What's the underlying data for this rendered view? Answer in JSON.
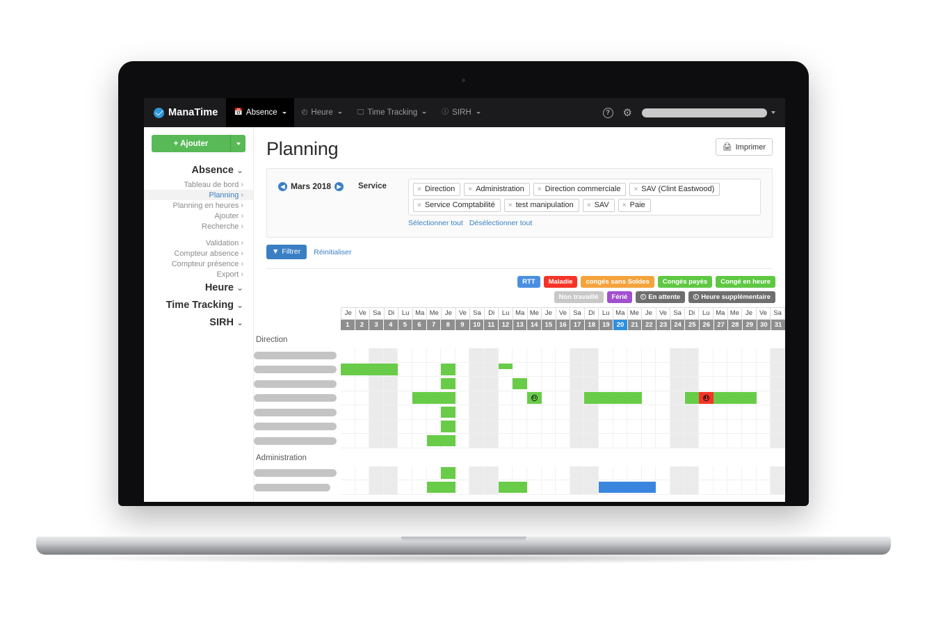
{
  "app": {
    "brand": "ManaTime",
    "brand_icon": "manatime-logo-icon"
  },
  "topnav": {
    "items": [
      {
        "label": "Absence",
        "icon": "calendar-icon",
        "active": true
      },
      {
        "label": "Heure",
        "icon": "clock-icon",
        "active": false
      },
      {
        "label": "Time Tracking",
        "icon": "device-icon",
        "active": false
      },
      {
        "label": "SIRH",
        "icon": "info-icon",
        "active": false
      }
    ],
    "help_icon": "question-mark-icon",
    "settings_icon": "gear-icon",
    "user_menu_placeholder": ""
  },
  "sidebar": {
    "add_button": "+ Ajouter",
    "add_caret_icon": "chevron-down-icon",
    "groups": [
      {
        "title": "Absence",
        "chevron": "⌄",
        "links": [
          {
            "label": "Tableau de bord",
            "current": false
          },
          {
            "label": "Planning",
            "current": true
          },
          {
            "label": "Planning en heures",
            "current": false
          },
          {
            "label": "Ajouter",
            "current": false
          },
          {
            "label": "Recherche",
            "current": false
          },
          {
            "spacer": true
          },
          {
            "label": "Validation",
            "current": false
          },
          {
            "label": "Compteur absence",
            "current": false
          },
          {
            "label": "Compteur présence",
            "current": false
          },
          {
            "label": "Export",
            "current": false
          }
        ]
      },
      {
        "title": "Heure",
        "chevron": "⌄",
        "links": []
      },
      {
        "title": "Time Tracking",
        "chevron": "⌄",
        "links": []
      },
      {
        "title": "SIRH",
        "chevron": "⌄",
        "links": []
      }
    ],
    "link_arrow": "›"
  },
  "page": {
    "title": "Planning",
    "print_button": "Imprimer",
    "print_icon": "printer-icon"
  },
  "filters": {
    "month": "Mars 2018",
    "prev_icon": "chevron-left-circle-icon",
    "next_icon": "chevron-right-circle-icon",
    "service_label": "Service",
    "tags": [
      "Direction",
      "Administration",
      "Direction commerciale",
      "SAV (Clint Eastwood)",
      "Service Comptabilité",
      "test manipulation",
      "SAV",
      "Paie"
    ],
    "tag_remove_icon": "×",
    "select_all": "Sélectionner tout",
    "deselect_all": "Désélectionner tout",
    "filter_button": "Filtrer",
    "filter_icon": "funnel-icon",
    "reset_button": "Réinitialiser"
  },
  "legend": {
    "row1": [
      {
        "label": "RTT",
        "color": "#4a8fe0"
      },
      {
        "label": "Maladie",
        "color": "#f53427"
      },
      {
        "label": "congés sans Soldes",
        "color": "#f5a33c"
      },
      {
        "label": "Congés payés",
        "color": "#5fc843"
      },
      {
        "label": "Congé en heure",
        "color": "#5fc843"
      }
    ],
    "row2": [
      {
        "label": "Non travaillé",
        "color": "#c8c8c8",
        "icon": null
      },
      {
        "label": "Férié",
        "color": "#a14fd0",
        "icon": null
      },
      {
        "label": "En attente",
        "color": "#6e6e6e",
        "icon": "pending-clock-icon"
      },
      {
        "label": "Heure supplémentaire",
        "color": "#6e6e6e",
        "icon": "pending-clock-icon"
      }
    ]
  },
  "calendar": {
    "day_names": [
      "Je",
      "Ve",
      "Sa",
      "Di",
      "Lu",
      "Ma",
      "Me",
      "Je",
      "Ve",
      "Sa",
      "Di",
      "Lu",
      "Ma",
      "Me",
      "Je",
      "Ve",
      "Sa",
      "Di",
      "Lu",
      "Ma",
      "Me",
      "Je",
      "Ve",
      "Sa",
      "Di",
      "Lu",
      "Ma",
      "Me",
      "Je",
      "Ve",
      "Sa"
    ],
    "day_numbers": [
      1,
      2,
      3,
      4,
      5,
      6,
      7,
      8,
      9,
      10,
      11,
      12,
      13,
      14,
      15,
      16,
      17,
      18,
      19,
      20,
      21,
      22,
      23,
      24,
      25,
      26,
      27,
      28,
      29,
      30,
      31
    ],
    "today": 20,
    "weekend_days": [
      3,
      4,
      10,
      11,
      17,
      18,
      24,
      25,
      31
    ],
    "groups": [
      {
        "name": "Direction",
        "rows": [
          {
            "name_width": 128,
            "bars": []
          },
          {
            "name_width": 128,
            "bars": [
              {
                "start": 1,
                "span": 4,
                "type": "green"
              },
              {
                "start": 8,
                "span": 1,
                "type": "green"
              },
              {
                "start": 12,
                "span": 1,
                "type": "green",
                "half": "top"
              }
            ]
          },
          {
            "name_width": 128,
            "bars": [
              {
                "start": 8,
                "span": 1,
                "type": "green"
              },
              {
                "start": 13,
                "span": 1,
                "type": "green"
              }
            ]
          },
          {
            "name_width": 130,
            "bars": [
              {
                "start": 6,
                "span": 1,
                "type": "green"
              },
              {
                "start": 7,
                "span": 1,
                "type": "green"
              },
              {
                "start": 8,
                "span": 1,
                "type": "green"
              },
              {
                "start": 14,
                "span": 1,
                "type": "green",
                "icon": "pending-clock-icon"
              },
              {
                "start": 18,
                "span": 4,
                "type": "green"
              },
              {
                "start": 25,
                "span": 1,
                "type": "green"
              },
              {
                "start": 26,
                "span": 1,
                "type": "red",
                "icon": "pending-clock-icon"
              },
              {
                "start": 27,
                "span": 3,
                "type": "green"
              }
            ]
          },
          {
            "name_width": 122,
            "bars": [
              {
                "start": 8,
                "span": 1,
                "type": "green"
              }
            ]
          },
          {
            "name_width": 126,
            "bars": [
              {
                "start": 8,
                "span": 1,
                "type": "green"
              }
            ]
          },
          {
            "name_width": 128,
            "bars": [
              {
                "start": 7,
                "span": 1,
                "type": "green"
              },
              {
                "start": 8,
                "span": 1,
                "type": "green"
              }
            ]
          }
        ]
      },
      {
        "name": "Administration",
        "rows": [
          {
            "name_width": 128,
            "bars": [
              {
                "start": 8,
                "span": 1,
                "type": "green"
              }
            ]
          },
          {
            "name_width": 110,
            "bars": [
              {
                "start": 7,
                "span": 1,
                "type": "green"
              },
              {
                "start": 8,
                "span": 1,
                "type": "green"
              },
              {
                "start": 12,
                "span": 1,
                "type": "green"
              },
              {
                "start": 13,
                "span": 1,
                "type": "green"
              },
              {
                "start": 19,
                "span": 4,
                "type": "blue"
              }
            ]
          }
        ]
      }
    ]
  }
}
